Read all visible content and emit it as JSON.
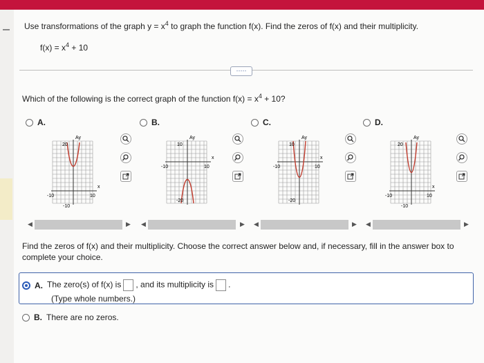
{
  "question": {
    "instruction_pre": "Use transformations of the graph y = x",
    "instruction_exp": "4",
    "instruction_post": " to graph the function f(x). Find the zeros of f(x) and their multiplicity.",
    "function_pre": "f(x) = x",
    "function_exp": "4",
    "function_post": " + 10"
  },
  "more_button": "·····",
  "prompt": {
    "pre": "Which of the following is the correct graph of the function f(x) = x",
    "exp": "4",
    "post": " + 10?"
  },
  "options": [
    {
      "label": "A.",
      "y_axis": "Ay",
      "x_axis": "x",
      "top_tick": "20",
      "right_tick": "10",
      "left_tick": "-10",
      "bottom_tick": "-10"
    },
    {
      "label": "B.",
      "y_axis": "Ay",
      "x_axis": "x",
      "top_tick": "10",
      "right_tick": "10",
      "left_tick": "-10",
      "bottom_tick": "-20"
    },
    {
      "label": "C.",
      "y_axis": "Ay",
      "x_axis": "x",
      "top_tick": "10",
      "right_tick": "10",
      "left_tick": "-10",
      "bottom_tick": "-20"
    },
    {
      "label": "D.",
      "y_axis": "Ay",
      "x_axis": "x",
      "top_tick": "20",
      "right_tick": "10",
      "left_tick": "-10",
      "bottom_tick": "-10"
    }
  ],
  "find": {
    "text": "Find the zeros of f(x) and their multiplicity. Choose the correct answer below and, if necessary, fill in the answer box to complete your choice."
  },
  "answers": {
    "a_label": "A.",
    "a_text1": "The zero(s) of f(x) is",
    "a_text2": ", and its multiplicity is",
    "a_text3": ".",
    "a_hint": "(Type whole numbers.)",
    "b_label": "B.",
    "b_text": "There are no zeros."
  },
  "colors": {
    "accent_bar": "#c4143c",
    "curve": "#c0392b",
    "link_blue": "#2b5bb8"
  }
}
